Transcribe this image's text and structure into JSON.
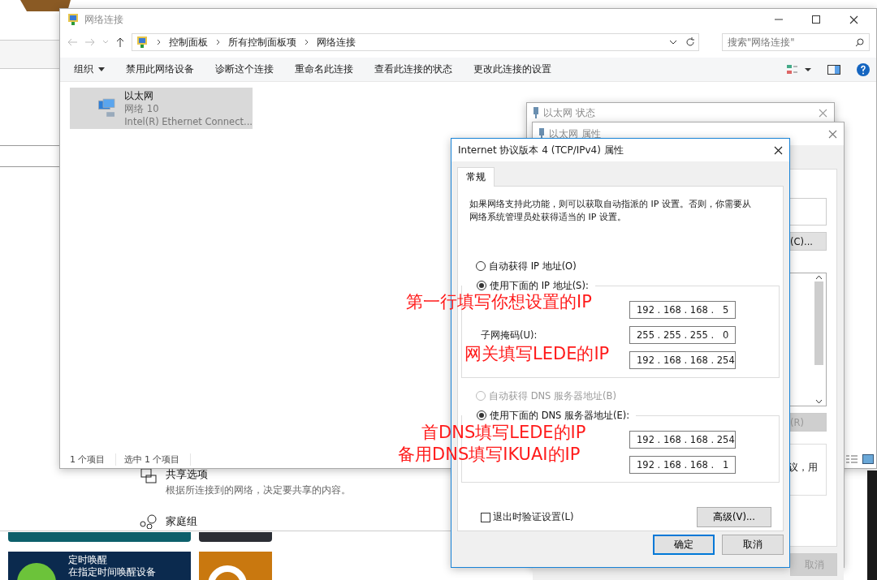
{
  "background_window": {
    "sections": [
      {
        "kind": "sharing",
        "title": "共享选项",
        "description": "根据所连接到的网络，决定要共享的内容。"
      },
      {
        "kind": "homegroup",
        "title": "家庭组"
      }
    ]
  },
  "tiles": [
    {
      "kind": "plain",
      "color": "#0d5f6b"
    },
    {
      "kind": "plain",
      "color": "#2b2e35"
    },
    {
      "kind": "wake",
      "color": "#0b2a4e",
      "title": "定时唤醒",
      "subtitle": "在指定时间唤醒设备"
    },
    {
      "kind": "badge",
      "color": "#c9780f"
    }
  ],
  "explorer": {
    "title": "网络连接",
    "breadcrumb": [
      "控制面板",
      "所有控制面板项",
      "网络连接"
    ],
    "search": {
      "placeholder": "搜索\"网络连接\""
    },
    "commands": [
      {
        "label": "组织",
        "dropdown": true
      },
      {
        "label": "禁用此网络设备",
        "dropdown": false
      },
      {
        "label": "诊断这个连接",
        "dropdown": false
      },
      {
        "label": "重命名此连接",
        "dropdown": false
      },
      {
        "label": "查看此连接的状态",
        "dropdown": false
      },
      {
        "label": "更改此连接的设置",
        "dropdown": false
      }
    ],
    "items": [
      {
        "name": "以太网",
        "network": "网络 10",
        "adapter": "Intel(R) Ethernet Connect...",
        "selected": true
      }
    ],
    "status": [
      "1 个项目",
      "选中 1 个项目"
    ]
  },
  "status_window": {
    "title": "以太网 状态"
  },
  "properties_window": {
    "title": "以太网 属性",
    "buttons": [
      {
        "label": "(C)...",
        "disabled": false
      },
      {
        "label": "(R)",
        "disabled": true
      }
    ],
    "description": "议，用",
    "cancel": {
      "label": "取消",
      "disabled": true
    }
  },
  "ipv4_dialog": {
    "title": "Internet 协议版本 4 (TCP/IPv4) 属性",
    "tabs": [
      {
        "label": "常规",
        "selected": true
      }
    ],
    "intro": "如果网络支持此功能，则可以获取自动指派的 IP 设置。否则，你需要从网络系统管理员处获得适当的 IP 设置。",
    "ip_options": [
      {
        "label": "自动获得 IP 地址(O)",
        "selected": false,
        "disabled": false
      },
      {
        "label": "使用下面的 IP 地址(S):",
        "selected": true,
        "disabled": false
      }
    ],
    "ip_fields": [
      {
        "value": "192 . 168 . 168 .   5"
      },
      {
        "label": "子网掩码(U):",
        "value": "255 . 255 . 255 .   0"
      },
      {
        "value": "192 . 168 . 168 . 254"
      }
    ],
    "dns_options": [
      {
        "label": "自动获得 DNS 服务器地址(B)",
        "selected": false,
        "disabled": true
      },
      {
        "label": "使用下面的 DNS 服务器地址(E):",
        "selected": true,
        "disabled": false
      }
    ],
    "dns_fields": [
      {
        "value": "192 . 168 . 168 . 254"
      },
      {
        "value": "192 . 168 . 168 .   1"
      }
    ],
    "validate": {
      "label": "退出时验证设置(L)",
      "checked": false
    },
    "advanced": "高级(V)...",
    "buttons": [
      {
        "label": "确定",
        "default": true
      },
      {
        "label": "取消",
        "default": false
      }
    ]
  },
  "annotations": [
    {
      "text": "第一行填写你想设置的IP"
    },
    {
      "text": "网关填写LEDE的IP"
    },
    {
      "text": "首DNS填写LEDE的IP"
    },
    {
      "text": "备用DNS填写IKUAI的IP"
    }
  ]
}
